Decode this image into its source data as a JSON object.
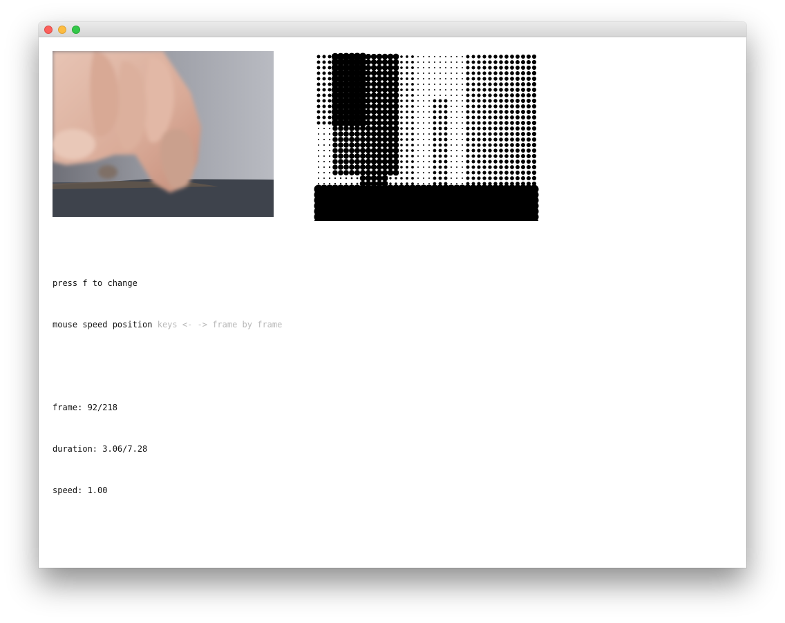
{
  "window": {
    "buttons": {
      "close": "close-button",
      "minimize": "minimize-button",
      "maximize": "zoom-button"
    }
  },
  "instructions": {
    "line1": "press f to change",
    "line2_main": "mouse speed position",
    "line2_hint": "keys <- -> frame by frame"
  },
  "stats": {
    "frame": "frame: 92/218",
    "duration": "duration: 3.06/7.28",
    "speed": "speed: 1.00"
  },
  "colors": {
    "hint_text": "#b8b8b8",
    "text": "#111111",
    "dots": "#000000"
  }
}
